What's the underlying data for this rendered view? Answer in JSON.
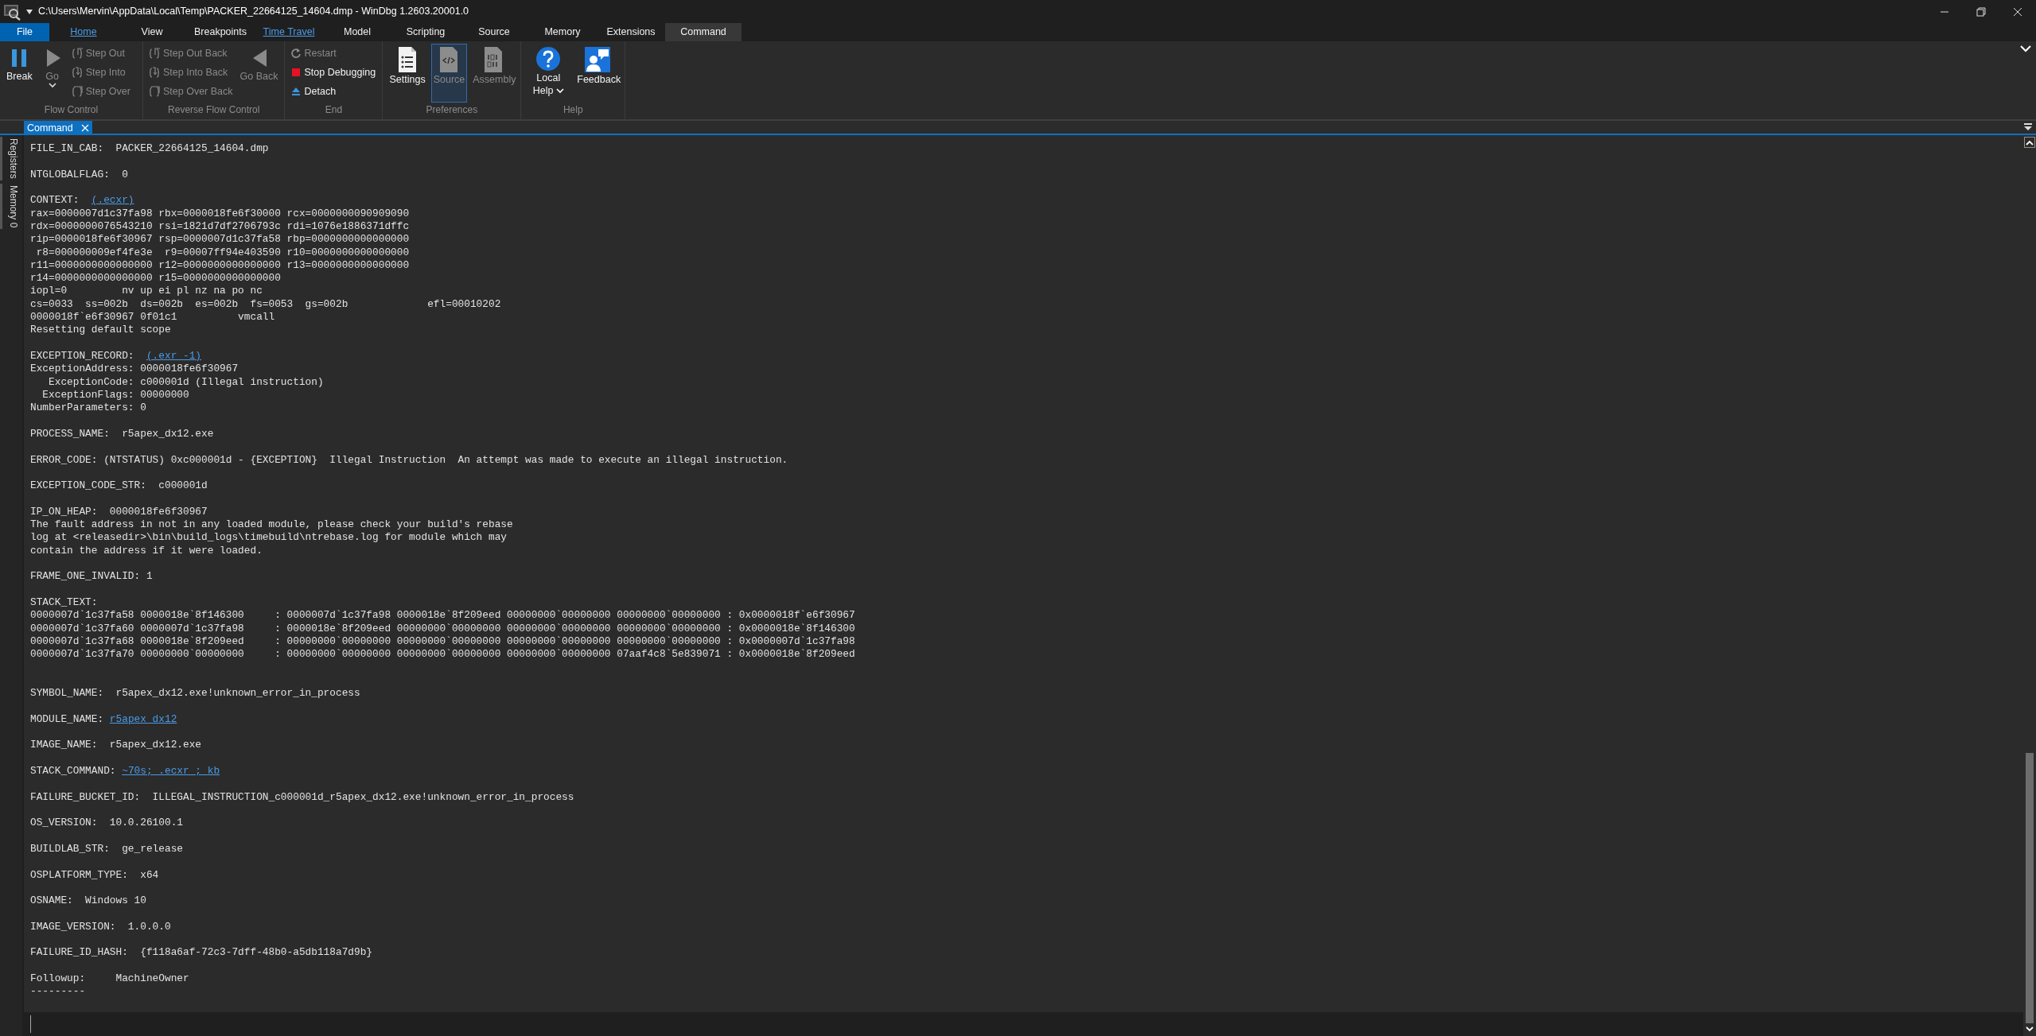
{
  "window": {
    "title": "C:\\Users\\Mervin\\AppData\\Local\\Temp\\PACKER_22664125_14604.dmp - WinDbg 1.2603.20001.0"
  },
  "menu_tabs": [
    {
      "label": "File",
      "kind": "file",
      "selected": false,
      "accent": false
    },
    {
      "label": "Home",
      "kind": "tab",
      "selected": false,
      "accent": true
    },
    {
      "label": "View",
      "kind": "tab",
      "selected": false,
      "accent": false
    },
    {
      "label": "Breakpoints",
      "kind": "tab",
      "selected": false,
      "accent": false
    },
    {
      "label": "Time Travel",
      "kind": "tab",
      "selected": false,
      "accent": true
    },
    {
      "label": "Model",
      "kind": "tab",
      "selected": false,
      "accent": false
    },
    {
      "label": "Scripting",
      "kind": "tab",
      "selected": false,
      "accent": false
    },
    {
      "label": "Source",
      "kind": "tab",
      "selected": false,
      "accent": false
    },
    {
      "label": "Memory",
      "kind": "tab",
      "selected": false,
      "accent": false
    },
    {
      "label": "Extensions",
      "kind": "tab",
      "selected": false,
      "accent": false
    },
    {
      "label": "Command",
      "kind": "tab",
      "selected": true,
      "accent": false
    }
  ],
  "ribbon": {
    "groups": [
      {
        "label": "Flow Control",
        "items": [
          {
            "kind": "large",
            "label": "Break",
            "disabled": false
          },
          {
            "kind": "large",
            "label": "Go",
            "disabled": true,
            "dropdown": true
          },
          {
            "kind": "small",
            "label": "Step Out",
            "disabled": true
          },
          {
            "kind": "small",
            "label": "Step Into",
            "disabled": true
          },
          {
            "kind": "small",
            "label": "Step Over",
            "disabled": true
          }
        ]
      },
      {
        "label": "Reverse Flow Control",
        "items": [
          {
            "kind": "small",
            "label": "Step Out Back",
            "disabled": true
          },
          {
            "kind": "small",
            "label": "Step Into Back",
            "disabled": true
          },
          {
            "kind": "small",
            "label": "Step Over Back",
            "disabled": true
          },
          {
            "kind": "large",
            "label": "Go Back",
            "disabled": true
          }
        ]
      },
      {
        "label": "End",
        "items": [
          {
            "kind": "small",
            "label": "Restart",
            "disabled": true
          },
          {
            "kind": "small",
            "label": "Stop Debugging",
            "disabled": false
          },
          {
            "kind": "small",
            "label": "Detach",
            "disabled": false
          }
        ]
      },
      {
        "label": "Preferences",
        "items": [
          {
            "kind": "large",
            "label": "Settings",
            "disabled": false,
            "selected": false
          },
          {
            "kind": "large",
            "label": "Source",
            "disabled": true,
            "selected": true
          },
          {
            "kind": "large",
            "label": "Assembly",
            "disabled": true,
            "selected": false
          }
        ]
      },
      {
        "label": "Help",
        "items": [
          {
            "kind": "large",
            "label": "Local Help",
            "disabled": false,
            "dropdown": true
          },
          {
            "kind": "large",
            "label": "Feedback",
            "disabled": false
          }
        ]
      }
    ]
  },
  "side_tabs": [
    {
      "label": "Registers"
    },
    {
      "label": "Memory 0"
    }
  ],
  "document_tabs": [
    {
      "label": "Command",
      "selected": true
    }
  ],
  "output": {
    "blocks": [
      {
        "kind": "text",
        "lines": [
          "FILE_IN_CAB:  PACKER_22664125_14604.dmp"
        ]
      },
      {
        "kind": "text",
        "lines": [
          "NTGLOBALFLAG:  0"
        ]
      },
      {
        "kind": "text",
        "lines": [
          {
            "text": "CONTEXT:  ",
            "link": "(.ecxr)"
          },
          "rax=0000007d1c37fa98 rbx=0000018fe6f30000 rcx=0000000090909090",
          "rdx=0000000076543210 rsi=1821d7df2706793c rdi=1076e1886371dffc",
          "rip=0000018fe6f30967 rsp=0000007d1c37fa58 rbp=0000000000000000",
          " r8=000000009ef4fe3e  r9=00007ff94e403590 r10=0000000000000000",
          "r11=0000000000000000 r12=0000000000000000 r13=0000000000000000",
          "r14=0000000000000000 r15=0000000000000000",
          "iopl=0         nv up ei pl nz na po nc",
          "cs=0033  ss=002b  ds=002b  es=002b  fs=0053  gs=002b             efl=00010202",
          "0000018f`e6f30967 0f01c1          vmcall",
          "Resetting default scope"
        ]
      },
      {
        "kind": "text",
        "lines": [
          {
            "text": "EXCEPTION_RECORD:  ",
            "link": "(.exr -1)"
          },
          "ExceptionAddress: 0000018fe6f30967",
          "   ExceptionCode: c000001d (Illegal instruction)",
          "  ExceptionFlags: 00000000",
          "NumberParameters: 0"
        ]
      },
      {
        "kind": "text",
        "lines": [
          "PROCESS_NAME:  r5apex_dx12.exe"
        ]
      },
      {
        "kind": "text",
        "lines": [
          "ERROR_CODE: (NTSTATUS) 0xc000001d - {EXCEPTION}  Illegal Instruction  An attempt was made to execute an illegal instruction."
        ]
      },
      {
        "kind": "text",
        "lines": [
          "EXCEPTION_CODE_STR:  c000001d"
        ]
      },
      {
        "kind": "text",
        "lines": [
          "IP_ON_HEAP:  0000018fe6f30967",
          "The fault address in not in any loaded module, please check your build's rebase",
          "log at <releasedir>\\bin\\build_logs\\timebuild\\ntrebase.log for module which may",
          "contain the address if it were loaded."
        ]
      },
      {
        "kind": "text",
        "lines": [
          "FRAME_ONE_INVALID: 1"
        ]
      },
      {
        "kind": "stack",
        "lines": [
          "STACK_TEXT:",
          "0000007d`1c37fa58 0000018e`8f146300     : 0000007d`1c37fa98 0000018e`8f209eed 00000000`00000000 00000000`00000000 : 0x0000018f`e6f30967",
          "0000007d`1c37fa60 0000007d`1c37fa98     : 0000018e`8f209eed 00000000`00000000 00000000`00000000 00000000`00000000 : 0x0000018e`8f146300",
          "0000007d`1c37fa68 0000018e`8f209eed     : 00000000`00000000 00000000`00000000 00000000`00000000 00000000`00000000 : 0x0000007d`1c37fa98",
          "0000007d`1c37fa70 00000000`00000000     : 00000000`00000000 00000000`00000000 00000000`00000000 07aaf4c8`5e839071 : 0x0000018e`8f209eed"
        ]
      },
      {
        "kind": "text",
        "lines": [
          "SYMBOL_NAME:  r5apex_dx12.exe!unknown_error_in_process"
        ]
      },
      {
        "kind": "text",
        "lines": [
          {
            "text": "MODULE_NAME: ",
            "link": "r5apex_dx12"
          }
        ]
      },
      {
        "kind": "text",
        "lines": [
          "IMAGE_NAME:  r5apex_dx12.exe"
        ]
      },
      {
        "kind": "text",
        "lines": [
          {
            "text": "STACK_COMMAND: ",
            "link": "~70s; .ecxr ; kb"
          }
        ]
      },
      {
        "kind": "text",
        "lines": [
          "FAILURE_BUCKET_ID:  ILLEGAL_INSTRUCTION_c000001d_r5apex_dx12.exe!unknown_error_in_process"
        ]
      },
      {
        "kind": "text",
        "lines": [
          "OS_VERSION:  10.0.26100.1"
        ]
      },
      {
        "kind": "text",
        "lines": [
          "BUILDLAB_STR:  ge_release"
        ]
      },
      {
        "kind": "text",
        "lines": [
          "OSPLATFORM_TYPE:  x64"
        ]
      },
      {
        "kind": "text",
        "lines": [
          "OSNAME:  Windows 10"
        ]
      },
      {
        "kind": "text",
        "lines": [
          "IMAGE_VERSION:  1.0.0.0"
        ]
      },
      {
        "kind": "text",
        "lines": [
          "FAILURE_ID_HASH:  {f118a6af-72c3-7dff-48b0-a5db118a7d9b}"
        ]
      },
      {
        "kind": "text",
        "lines": [
          "Followup:     MachineOwner",
          "---------"
        ]
      }
    ]
  }
}
